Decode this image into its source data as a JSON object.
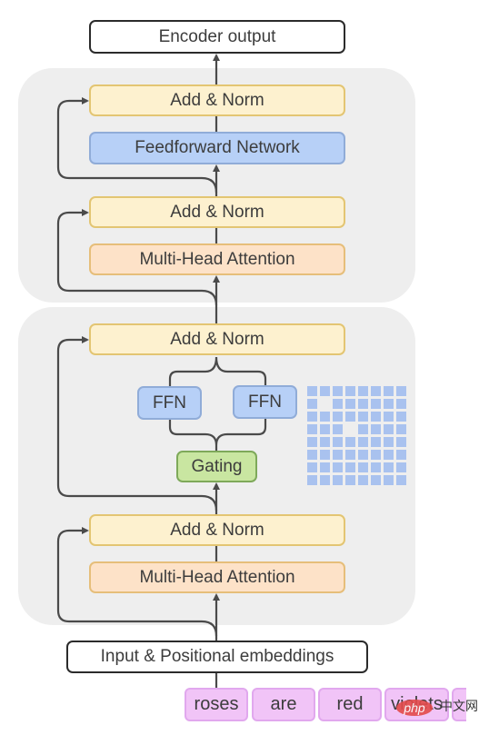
{
  "diagram": {
    "output": {
      "label": "Encoder output"
    },
    "top_block": {
      "add_norm_upper": "Add & Norm",
      "feedforward": "Feedforward Network",
      "add_norm_lower": "Add & Norm",
      "attention": "Multi-Head Attention"
    },
    "moe_block": {
      "add_norm_upper": "Add & Norm",
      "experts": [
        "FFN",
        "FFN"
      ],
      "gating": "Gating",
      "add_norm_lower": "Add & Norm",
      "attention": "Multi-Head Attention",
      "routing_grid": {
        "rows": 8,
        "cols": 8,
        "empty_cells": [
          [
            1,
            1
          ],
          [
            3,
            3
          ]
        ]
      }
    },
    "input": {
      "label": "Input & Positional embeddings"
    },
    "tokens": [
      "roses",
      "are",
      "red",
      "violets",
      ""
    ],
    "watermark": {
      "logo": "php",
      "text": "中文网"
    },
    "colors": {
      "panel": "#eeeeee",
      "add_norm": "#fdf1cf",
      "feedforward": "#b7d0f7",
      "attention": "#fde2c8",
      "gating": "#c9e6a1",
      "token": "#f1c4f7",
      "grid_cell": "#a9c2ef",
      "wire": "#4a4a4a"
    }
  }
}
